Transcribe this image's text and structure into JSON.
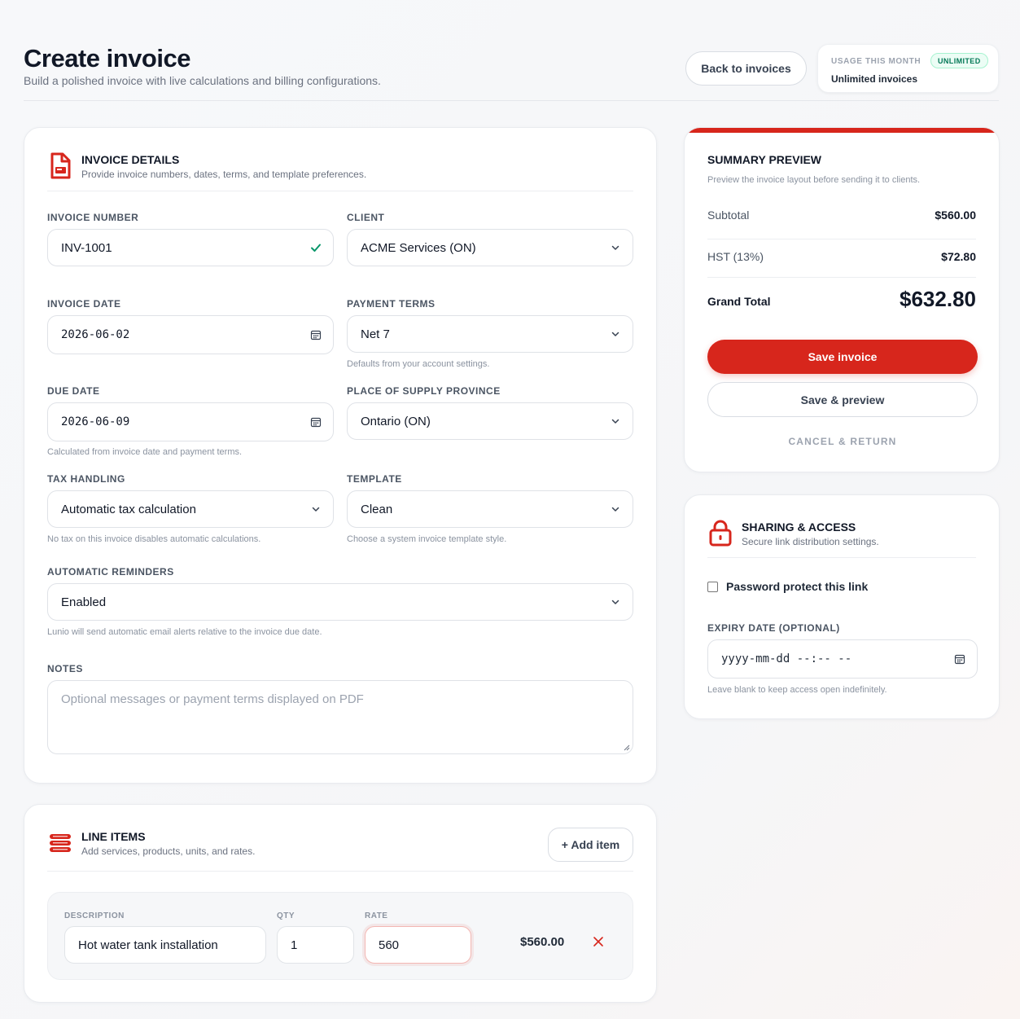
{
  "header": {
    "title": "Create invoice",
    "subtitle": "Build a polished invoice with live calculations and billing configurations.",
    "back_label": "Back to invoices",
    "usage_label": "USAGE THIS MONTH",
    "usage_badge": "UNLIMITED",
    "usage_value": "Unlimited invoices"
  },
  "details": {
    "title": "INVOICE DETAILS",
    "description": "Provide invoice numbers, dates, terms, and template preferences.",
    "invoice_number": {
      "label": "INVOICE NUMBER",
      "value": "INV-1001"
    },
    "client": {
      "label": "CLIENT",
      "value": "ACME Services (ON)"
    },
    "invoice_date": {
      "label": "INVOICE DATE",
      "value": "2026-06-02"
    },
    "payment_terms": {
      "label": "PAYMENT TERMS",
      "value": "Net 7",
      "help": "Defaults from your account settings."
    },
    "due_date": {
      "label": "DUE DATE",
      "value": "2026-06-09",
      "help": "Calculated from invoice date and payment terms."
    },
    "province": {
      "label": "PLACE OF SUPPLY PROVINCE",
      "value": "Ontario (ON)"
    },
    "tax": {
      "label": "TAX HANDLING",
      "value": "Automatic tax calculation",
      "help": "No tax on this invoice disables automatic calculations."
    },
    "template": {
      "label": "TEMPLATE",
      "value": "Clean",
      "help": "Choose a system invoice template style."
    },
    "reminders": {
      "label": "AUTOMATIC REMINDERS",
      "value": "Enabled",
      "help": "Lunio will send automatic email alerts relative to the invoice due date."
    },
    "notes": {
      "label": "NOTES",
      "placeholder": "Optional messages or payment terms displayed on PDF"
    }
  },
  "line_items": {
    "title": "LINE ITEMS",
    "description": "Add services, products, units, and rates.",
    "add_label": "+ Add item",
    "columns": {
      "description": "DESCRIPTION",
      "qty": "QTY",
      "rate": "RATE"
    },
    "rows": [
      {
        "description": "Hot water tank installation",
        "qty": "1",
        "rate": "560",
        "amount": "$560.00"
      }
    ]
  },
  "summary": {
    "title": "SUMMARY PREVIEW",
    "description": "Preview the invoice layout before sending it to clients.",
    "subtotal_label": "Subtotal",
    "subtotal_value": "$560.00",
    "tax_label": "HST (13%)",
    "tax_value": "$72.80",
    "grand_label": "Grand Total",
    "grand_value": "$632.80",
    "save_label": "Save invoice",
    "preview_label": "Save & preview",
    "cancel_label": "CANCEL & RETURN"
  },
  "sharing": {
    "title": "SHARING & ACCESS",
    "description": "Secure link distribution settings.",
    "password_label": "Password protect this link",
    "password_checked": false,
    "expiry_label": "EXPIRY DATE (OPTIONAL)",
    "expiry_placeholder": "yyyy-mm-dd --:-- --",
    "expiry_help": "Leave blank to keep access open indefinitely."
  },
  "colors": {
    "accent": "#d7261c",
    "success": "#059669",
    "badge_bg": "#ecfdf5"
  },
  "icons": {
    "details": "document-icon",
    "line_items": "stack-icon",
    "sharing": "lock-icon",
    "dropdown": "chevron-down-icon",
    "calendar": "calendar-icon",
    "valid": "check-icon",
    "remove": "close-icon"
  }
}
